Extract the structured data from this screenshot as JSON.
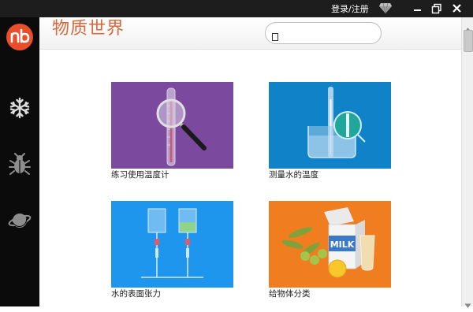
{
  "titlebar": {
    "login_label": "登录/注册",
    "icons": [
      "diamond-icon",
      "minimize-icon",
      "restore-icon",
      "close-icon"
    ]
  },
  "sidebar": {
    "logo_text": "nb",
    "items": [
      {
        "icon": "snowflake-icon"
      },
      {
        "icon": "bug-icon"
      },
      {
        "icon": "planet-icon"
      }
    ]
  },
  "header": {
    "title": "物质世界",
    "search": {
      "placeholder": "",
      "value": ""
    }
  },
  "cards": [
    {
      "caption": "练习使用温度计",
      "color": "#7b4a9e"
    },
    {
      "caption": "测量水的温度",
      "color": "#0f82c8"
    },
    {
      "caption": "水的表面张力",
      "color": "#1e96ee"
    },
    {
      "caption": "给物体分类",
      "color": "#f07d1f"
    }
  ],
  "colors": {
    "titlebar": "#1d1d1d",
    "sidebar": "#0b0b0b",
    "logo": "#e84d2c",
    "title_text": "#d9673b"
  }
}
